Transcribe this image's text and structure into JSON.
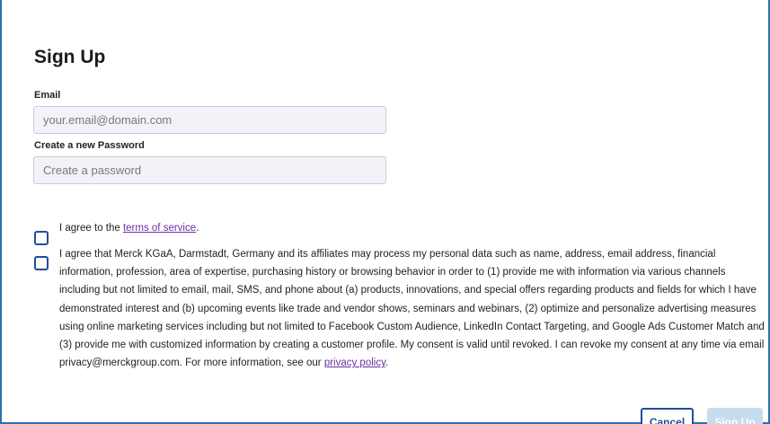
{
  "form": {
    "title": "Sign Up",
    "email_label": "Email",
    "email_placeholder": "your.email@domain.com",
    "password_label": "Create a new Password",
    "password_placeholder": "Create a password"
  },
  "consents": {
    "terms_prefix": "I agree to the ",
    "terms_link": "terms of service",
    "terms_suffix": ".",
    "marketing_text": "I agree that Merck KGaA, Darmstadt, Germany and its affiliates may process my personal data such as name, address, email address, financial information, profession, area of expertise, purchasing history or browsing behavior in order to (1) provide me with information via various channels including but not limited to email, mail, SMS, and phone about (a) products, innovations, and special offers regarding products and fields for which I have demonstrated interest and (b) upcoming events like trade and vendor shows, seminars and webinars, (2) optimize and personalize advertising measures using online marketing services including but not limited to Facebook Custom Audience, LinkedIn Contact Targeting, and Google Ads Customer Match and (3) provide me with customized information by creating a customer profile. My consent is valid until revoked. I can revoke my consent at any time via email privacy@merckgroup.com. For more information, see our ",
    "privacy_link": "privacy policy",
    "privacy_suffix": "."
  },
  "actions": {
    "cancel_label": "Cancel",
    "signup_label": "Sign Up"
  },
  "colors": {
    "accent": "#1f4f99",
    "link": "#6b2fa0",
    "input_bg": "#f4f1f8",
    "signup_disabled_bg": "#c8dcef",
    "frame_border": "#2f6fb0"
  }
}
